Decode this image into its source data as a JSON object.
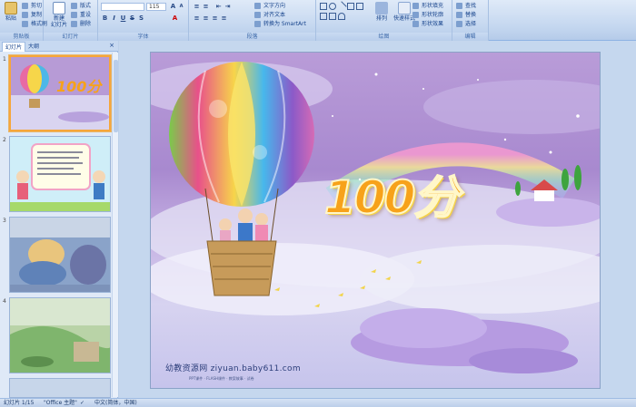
{
  "ribbon": {
    "clipboard": {
      "label": "剪贴板",
      "paste": "粘贴",
      "cut": "剪切",
      "copy": "复制",
      "format_painter": "格式刷"
    },
    "slides": {
      "label": "幻灯片",
      "new_slide": "新建\n幻灯片",
      "layout": "版式",
      "reset": "重设",
      "delete": "删除"
    },
    "font": {
      "label": "字体",
      "size": "115"
    },
    "paragraph": {
      "label": "段落",
      "text_direction": "文字方向",
      "align_text": "对齐文本",
      "convert_smartart": "转换为 SmartArt"
    },
    "drawing": {
      "label": "绘图",
      "arrange": "排列",
      "quick_styles": "快速样式",
      "shape_fill": "形状填充",
      "shape_outline": "形状轮廓",
      "shape_effects": "形状效果"
    },
    "editing": {
      "label": "编辑",
      "find": "查找",
      "replace": "替换",
      "select": "选择"
    }
  },
  "pane": {
    "tabs": [
      "幻灯片",
      "大纲"
    ],
    "close_glyph": "×",
    "thumbnails": [
      {
        "num": "1",
        "kind": "balloon"
      },
      {
        "num": "2",
        "kind": "kids"
      },
      {
        "num": "3",
        "kind": "photo"
      },
      {
        "num": "4",
        "kind": "photo2"
      }
    ]
  },
  "slide": {
    "title": "100分",
    "watermark": "幼教资源网 ziyuan.baby611.com",
    "watermark_sub": "PPT课件 · FLASH课件 · 教案故事 · 试卷"
  },
  "status": {
    "slide_count": "幻灯片 1/15",
    "theme": "\"Office 主题\"",
    "language": "中文(简体，中国)"
  },
  "colors": {
    "ribbon_bg": "#c3d6ef",
    "selected_border": "#f6a63a",
    "title_color": "#f7a21a"
  }
}
